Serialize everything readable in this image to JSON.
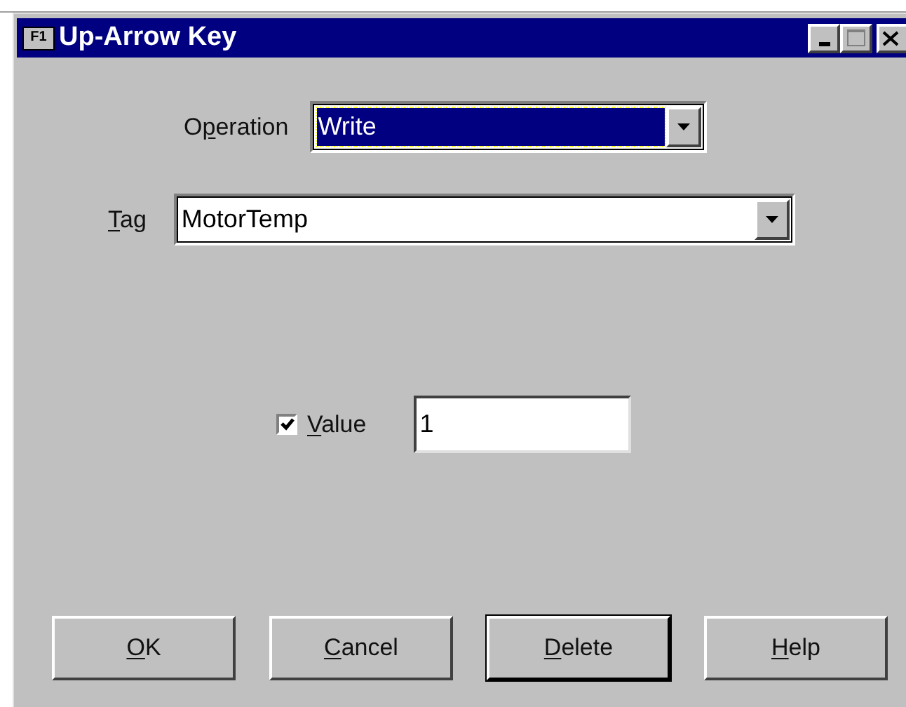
{
  "window": {
    "title": "Up-Arrow Key",
    "app_icon": "F1"
  },
  "operation": {
    "label": {
      "before": "O",
      "key": "p",
      "after": "eration"
    },
    "value": "Write",
    "focused": true
  },
  "tag": {
    "label": {
      "key": "T",
      "after": "ag"
    },
    "value": "MotorTemp",
    "focused": false
  },
  "value_field": {
    "label": {
      "key": "V",
      "after": "alue"
    },
    "checked": true,
    "value": "1"
  },
  "buttons": [
    {
      "label": {
        "key": "O",
        "after": "K"
      },
      "default": false
    },
    {
      "label": {
        "key": "C",
        "after": "ancel"
      },
      "default": false
    },
    {
      "label": {
        "key": "D",
        "after": "elete"
      },
      "default": true
    },
    {
      "label": {
        "key": "H",
        "after": "elp"
      },
      "default": false
    }
  ]
}
